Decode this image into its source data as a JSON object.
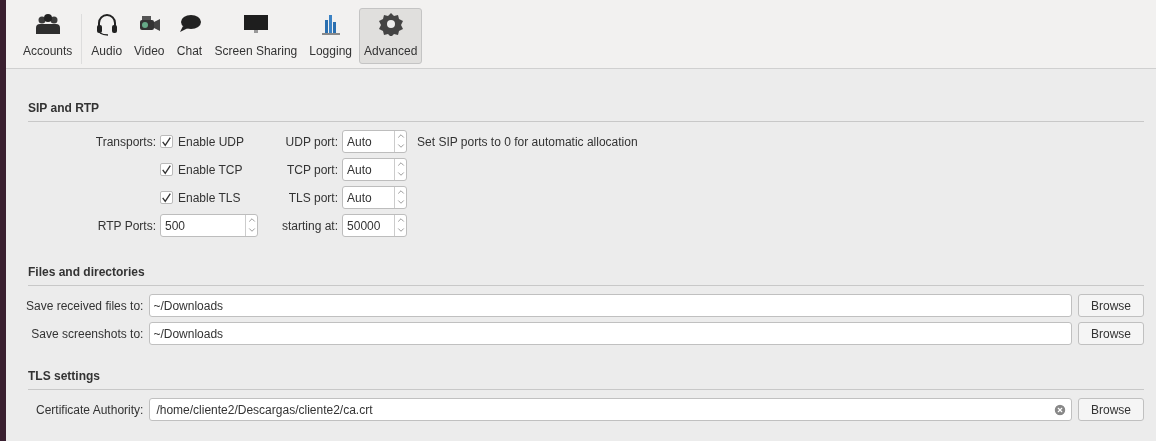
{
  "toolbar": [
    {
      "label": "Accounts",
      "kind": "accounts",
      "selected": false
    },
    {
      "label": "Audio",
      "kind": "headset",
      "selected": false
    },
    {
      "label": "Video",
      "kind": "camera",
      "selected": false
    },
    {
      "label": "Chat",
      "kind": "chat",
      "selected": false
    },
    {
      "label": "Screen Sharing",
      "kind": "monitor",
      "selected": false
    },
    {
      "label": "Logging",
      "kind": "chart",
      "selected": false
    },
    {
      "label": "Advanced",
      "kind": "gear",
      "selected": true
    }
  ],
  "sip": {
    "title": "SIP and RTP",
    "transports_label": "Transports:",
    "note": "Set SIP ports to 0 for automatic allocation",
    "transports": [
      {
        "label": "Enable UDP",
        "checked": true,
        "port_label": "UDP port:",
        "port": "Auto"
      },
      {
        "label": "Enable TCP",
        "checked": true,
        "port_label": "TCP port:",
        "port": "Auto"
      },
      {
        "label": "Enable TLS",
        "checked": true,
        "port_label": "TLS port:",
        "port": "Auto"
      }
    ],
    "rtp_label": "RTP Ports:",
    "rtp_value": "500",
    "start_label": "starting at:",
    "start_value": "50000"
  },
  "files": {
    "title": "Files and directories",
    "rows": [
      {
        "label": "Save received files to:",
        "value": "~/Downloads",
        "button": "Browse"
      },
      {
        "label": "Save screenshots to:",
        "value": "~/Downloads",
        "button": "Browse"
      }
    ]
  },
  "tls": {
    "title": "TLS settings",
    "label": "Certificate Authority:",
    "value": "/home/cliente2/Descargas/cliente2/ca.crt",
    "button": "Browse"
  }
}
